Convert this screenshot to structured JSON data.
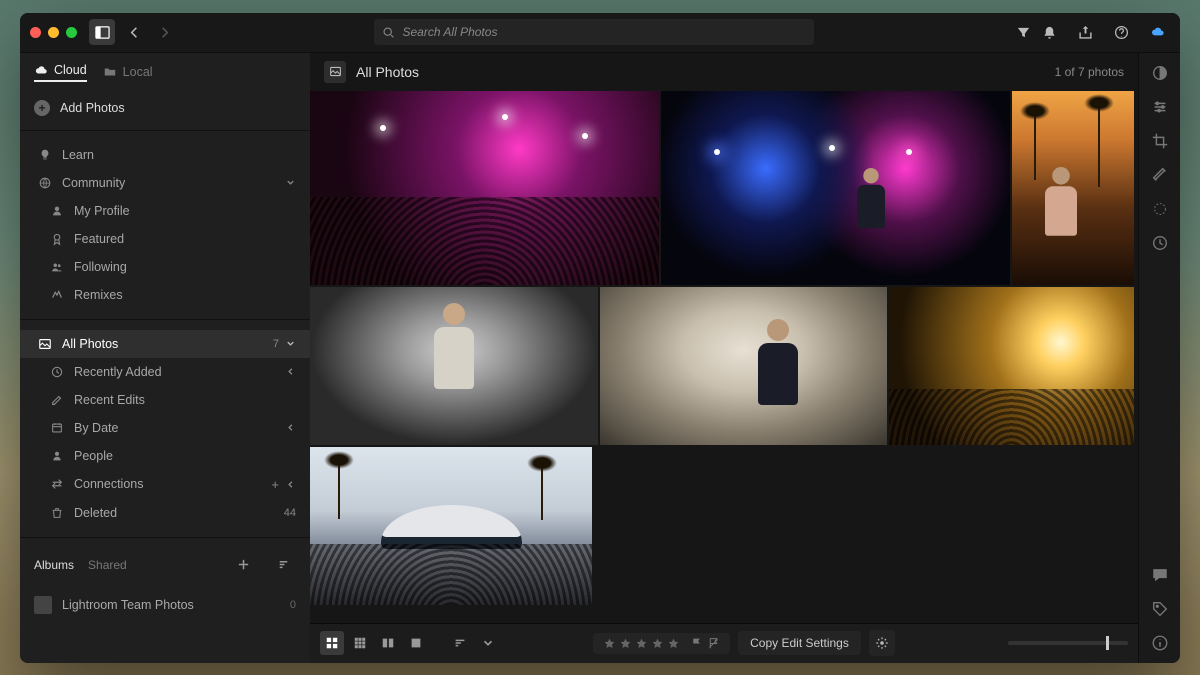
{
  "search": {
    "placeholder": "Search All Photos"
  },
  "sidebar": {
    "tabs": {
      "cloud": "Cloud",
      "local": "Local"
    },
    "add": "Add Photos",
    "learn": "Learn",
    "community": "Community",
    "profile": "My Profile",
    "featured": "Featured",
    "following": "Following",
    "remixes": "Remixes",
    "allphotos": {
      "label": "All Photos",
      "count": "7"
    },
    "recent": "Recently Added",
    "edits": "Recent Edits",
    "bydate": "By Date",
    "people": "People",
    "connections": "Connections",
    "deleted": {
      "label": "Deleted",
      "count": "44"
    },
    "albums": {
      "title": "Albums",
      "shared": "Shared"
    },
    "album1": {
      "label": "Lightroom Team Photos",
      "count": "0"
    }
  },
  "header": {
    "title": "All Photos",
    "count": "1 of 7 photos"
  },
  "toolbar": {
    "copy": "Copy Edit Settings"
  }
}
